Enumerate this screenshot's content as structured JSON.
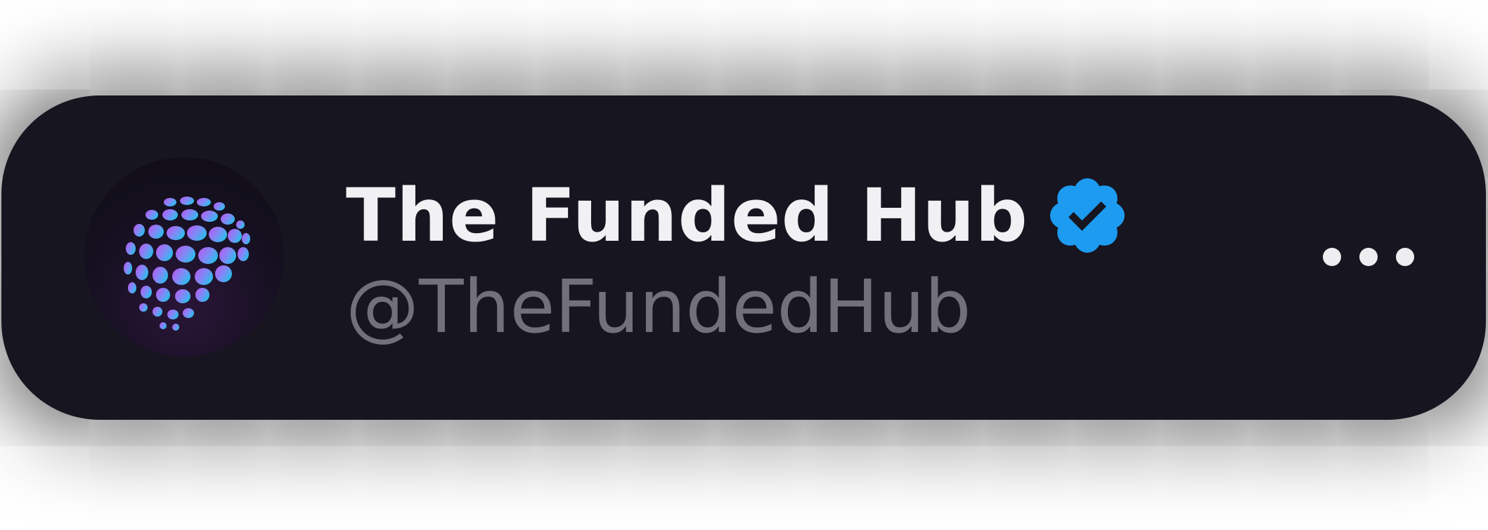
{
  "profile": {
    "display_name": "The Funded Hub",
    "handle": "@TheFundedHub",
    "verified": true,
    "avatar_icon": "dotted-globe-logo-icon",
    "verified_icon": "verified-badge-icon"
  },
  "actions": {
    "more_icon": "more-horizontal-icon"
  },
  "colors": {
    "card_background": "#171520",
    "name_text": "#f1f1f3",
    "handle_text": "#727079",
    "verified_badge": "#1d9bf0",
    "logo_gradient_start": "#b45cf0",
    "logo_gradient_end": "#18c8e8"
  }
}
